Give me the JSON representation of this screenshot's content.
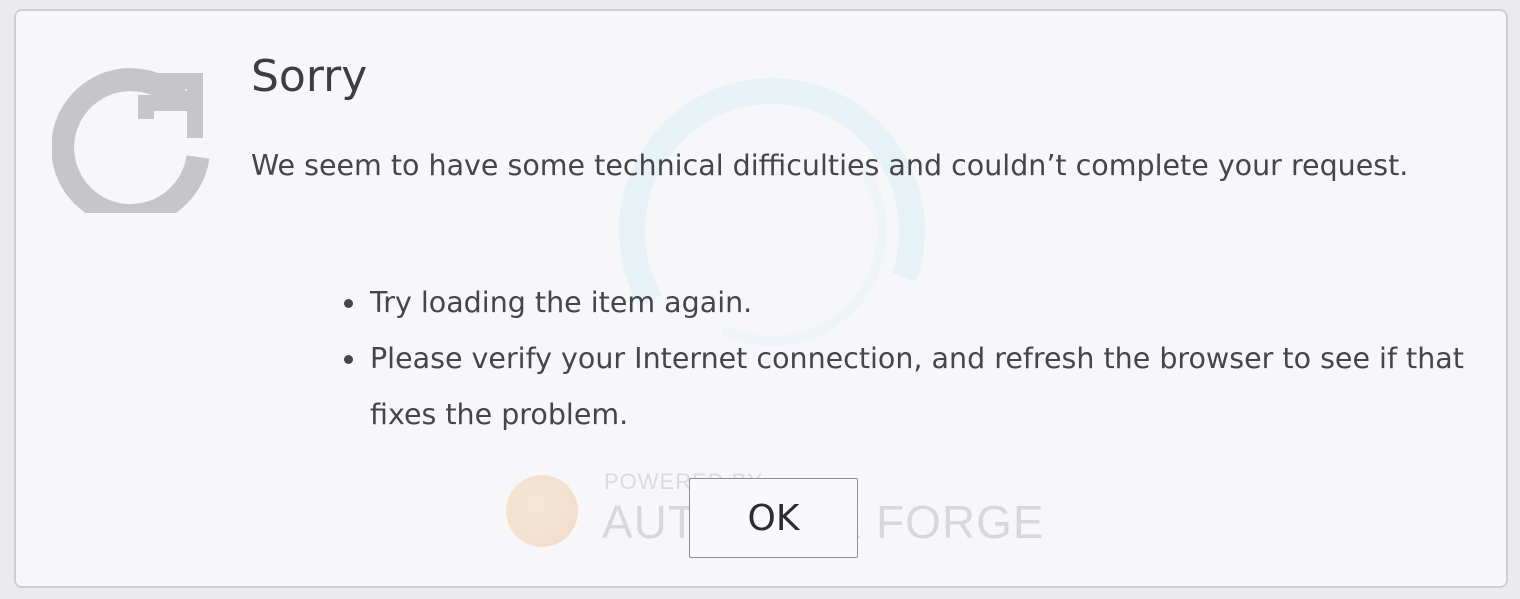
{
  "dialog": {
    "title": "Sorry",
    "message": "We seem to have some technical difficulties and couldn’t complete your request.",
    "tips": [
      "Try loading the item again.",
      "Please verify your Internet connection, and refresh the browser to see if that fixes the problem."
    ],
    "ok_label": "OK",
    "icon": "refresh-icon"
  },
  "background": {
    "brand_small": "POWERED BY",
    "brand_name": "AUTODESK FORGE"
  },
  "colors": {
    "dialog_background": "#f7f7f9",
    "icon_gray": "#c6c6c9",
    "text": "#45454a",
    "spinner_tint": "#bfe3f0"
  }
}
